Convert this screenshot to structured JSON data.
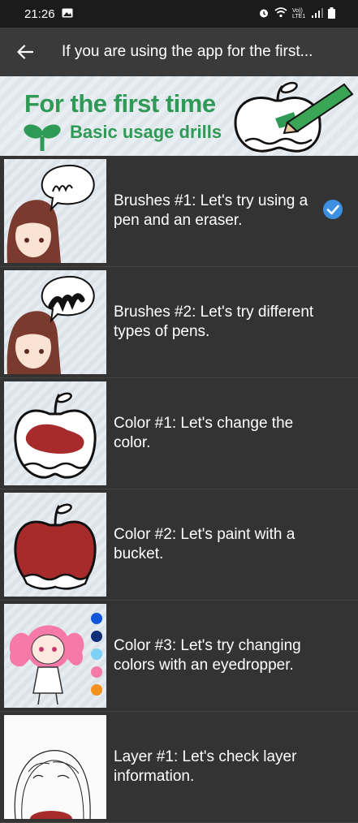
{
  "status": {
    "time": "21:26",
    "network": "Vo)) LTE1"
  },
  "app_bar": {
    "title": "If you are using the app for the first..."
  },
  "banner": {
    "title": "For the first time",
    "subtitle": "Basic usage drills"
  },
  "items": [
    {
      "label": "Brushes #1: Let's try using a pen and an eraser.",
      "completed": true
    },
    {
      "label": "Brushes #2: Let's try different types of pens.",
      "completed": false
    },
    {
      "label": "Color #1: Let's change the color.",
      "completed": false
    },
    {
      "label": "Color #2: Let's paint with a bucket.",
      "completed": false
    },
    {
      "label": "Color #3: Let's try changing colors with an eyedropper.",
      "completed": false
    },
    {
      "label": "Layer #1: Let's check layer information.",
      "completed": false
    }
  ],
  "palette": [
    "#1155dd",
    "#0f2e7a",
    "#7fd0f5",
    "#f57aa8",
    "#f5921e"
  ],
  "colors": {
    "accent_green": "#2f9a55",
    "check_blue": "#3d8fe0",
    "apple_red": "#a82b2b"
  }
}
